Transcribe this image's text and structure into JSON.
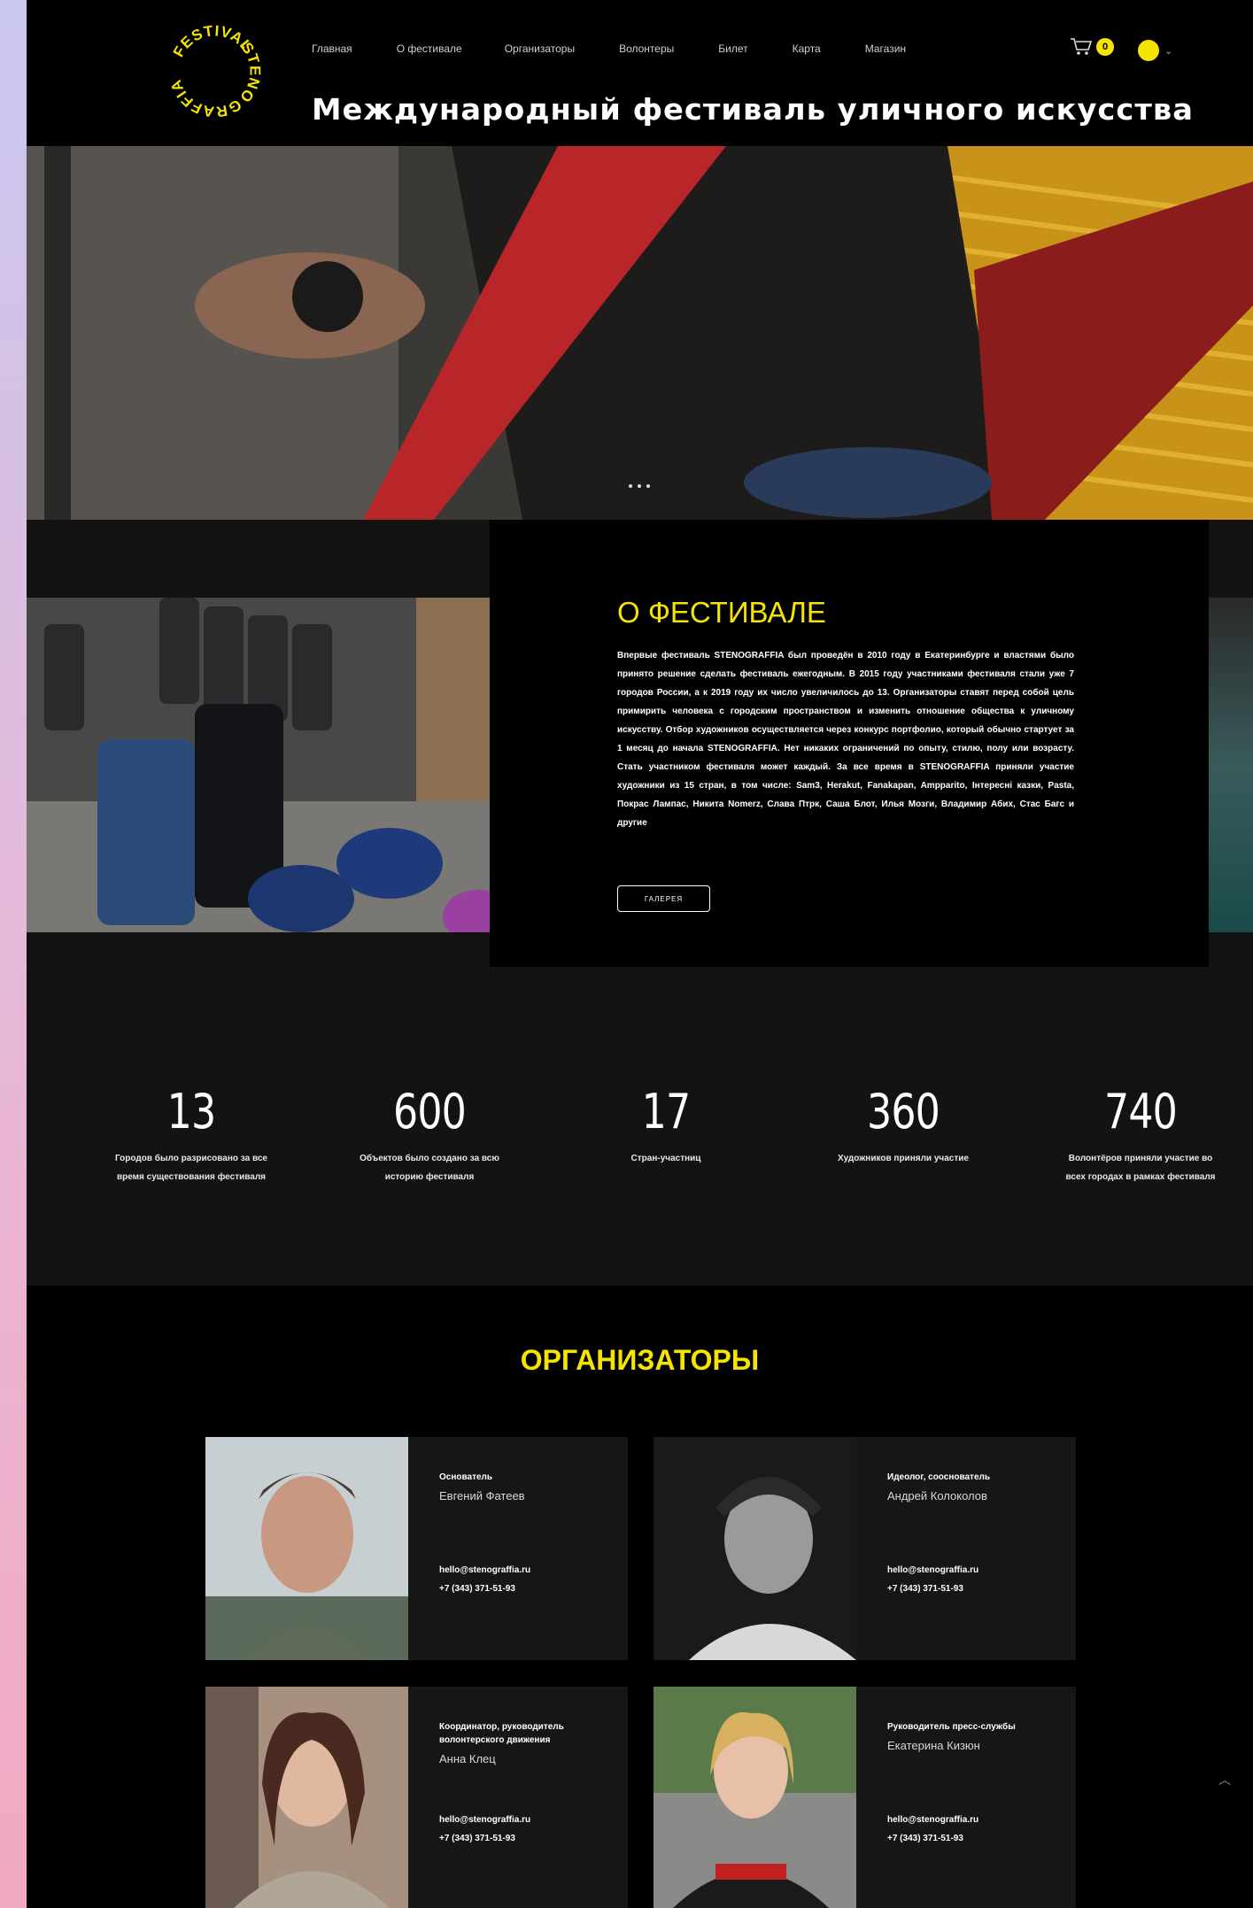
{
  "logo": {
    "text_top": "STENO",
    "text_left": "FESTIVAL",
    "text_bottom": "GRAFFIA",
    "color": "#f5e400"
  },
  "nav": [
    "Главная",
    "О фестивале",
    "Организаторы",
    "Волонтеры",
    "Билет",
    "Карта",
    "Магазин"
  ],
  "cart": {
    "icon": "cart-icon",
    "count": "0"
  },
  "lang": {
    "icon": "chevron-down-icon",
    "chevron": "⌄"
  },
  "tagline": "Международный фестиваль уличного искусства",
  "hero": {
    "slides": 3
  },
  "about": {
    "title": "О ФЕСТИВАЛЕ",
    "text": "Впервые фестиваль STENOGRAFFIA был проведён в 2010 году в Екатеринбурге и властями было принято решение сделать фестиваль ежегодным. В 2015 году участниками фестиваля стали уже 7 городов России, а к 2019 году их число увеличилось до 13. Организаторы ставят перед собой цель примирить человека с городским пространством и изменить отношение общества к уличному искусству. Отбор художников осуществляется через конкурс портфолио, который обычно стартует за 1 месяц до начала STENOGRAFFIA. Нет никаких ограничений по опыту, стилю, полу или возрасту. Стать участником фестиваля может каждый. За все время в STENOGRAFFIA приняли участие художники из 15 стран, в том числе: Sam3, Herakut, Fanakapan, Ampparito, Інтересні казки, Pasta, Покрас Лампас, Никита Nomerz, Слава Птрк, Саша Блот, Илья Мозги, Владимир Абих, Стас Багс и другие",
    "button": "ГАЛЕРЕЯ"
  },
  "stats": [
    {
      "num": "13",
      "label": "Городов было разрисовано за все время существования фестиваля"
    },
    {
      "num": "600",
      "label": "Объектов было создано за всю историю фестиваля"
    },
    {
      "num": "17",
      "label": "Стран-участниц"
    },
    {
      "num": "360",
      "label": "Художников приняли участие"
    },
    {
      "num": "740",
      "label": "Волонтёров приняли участие во всех городах в рамках фестиваля"
    }
  ],
  "organizers": {
    "title": "ОРГАНИЗАТОРЫ",
    "people": [
      {
        "role": "Основатель",
        "name": "Евгений Фатеев",
        "email": "hello@stenograffia.ru",
        "phone": "+7 (343) 371-51-93"
      },
      {
        "role": "Идеолог, сооснователь",
        "name": "Андрей Колоколов",
        "email": "hello@stenograffia.ru",
        "phone": "+7 (343) 371-51-93"
      },
      {
        "role": "Координатор, руководитель волонтерского движения",
        "name": "Анна Клец",
        "email": "hello@stenograffia.ru",
        "phone": "+7 (343) 371-51-93"
      },
      {
        "role": "Руководитель пресс-службы",
        "name": "Екатерина Кизюн",
        "email": "hello@stenograffia.ru",
        "phone": "+7 (343) 371-51-93"
      }
    ]
  },
  "scroll_top": {
    "icon": "chevron-up-icon",
    "glyph": "︿"
  }
}
